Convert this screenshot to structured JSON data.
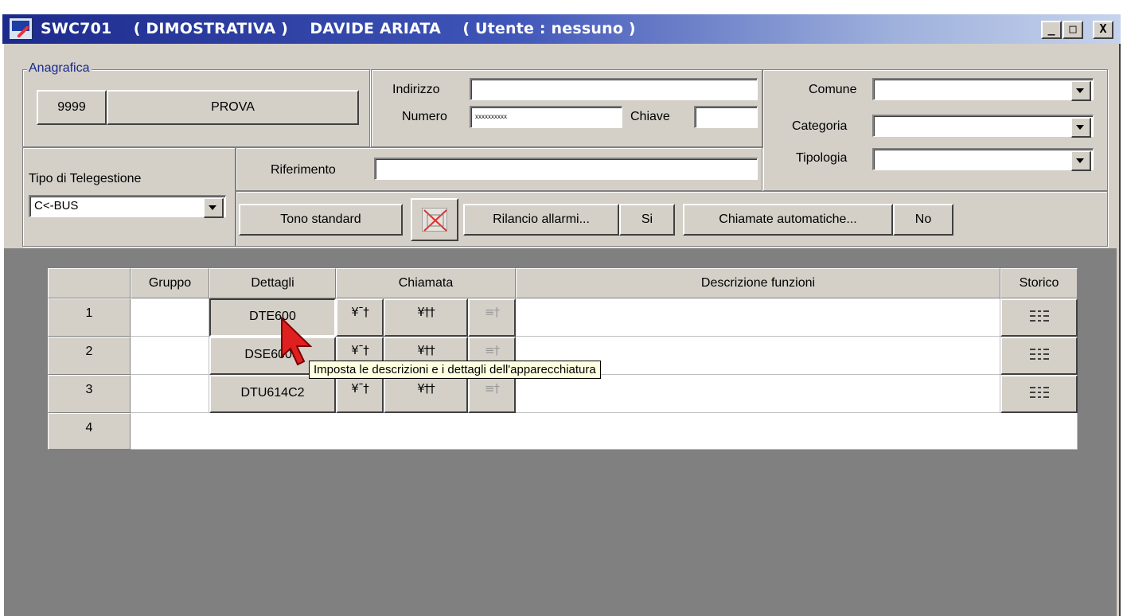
{
  "window": {
    "title": "SWC701    ( DIMOSTRATIVA )    DAVIDE ARIATA    ( Utente : nessuno )",
    "controls": {
      "minimize": "_",
      "maximize": "□",
      "close": "X"
    }
  },
  "anagrafica": {
    "legend": "Anagrafica",
    "code": "9999",
    "name": "PROVA",
    "indirizzo_label": "Indirizzo",
    "indirizzo_value": "",
    "numero_label": "Numero",
    "numero_value": "xxxxxxxxxx",
    "chiave_label": "Chiave",
    "chiave_value": "",
    "comune_label": "Comune",
    "comune_value": "",
    "categoria_label": "Categoria",
    "categoria_value": "",
    "tipologia_label": "Tipologia",
    "tipologia_value": "",
    "riferimento_label": "Riferimento",
    "riferimento_value": ""
  },
  "telegestione": {
    "label": "Tipo di Telegestione",
    "selected": "C<-BUS"
  },
  "toolbar": {
    "tono": "Tono standard",
    "rilancio": "Rilancio allarmi...",
    "rilancio_value": "Si",
    "chiamate": "Chiamate automatiche...",
    "chiamate_value": "No"
  },
  "grid": {
    "headers": {
      "gruppo": "Gruppo",
      "dettagli": "Dettagli",
      "chiamata": "Chiamata",
      "descrizione": "Descrizione funzioni",
      "storico": "Storico"
    },
    "rows": [
      {
        "num": "1",
        "gruppo": "",
        "dettagli": "DTE600",
        "descrizione": ""
      },
      {
        "num": "2",
        "gruppo": "",
        "dettagli": "DSE600S",
        "descrizione": ""
      },
      {
        "num": "3",
        "gruppo": "",
        "dettagli": "DTU614C2",
        "descrizione": ""
      },
      {
        "num": "4",
        "gruppo": "",
        "dettagli": "",
        "descrizione": ""
      }
    ]
  },
  "tooltip": "Imposta le descrizioni e i dettagli dell'apparecchiatura",
  "icons": {
    "app": "app-icon",
    "cursor": "arrow-cursor-icon",
    "no_tone": "no-tone-icon",
    "storico": "list-icon"
  },
  "colors": {
    "titlebar_start": "#1c2a8c",
    "titlebar_end": "#c6d3ec",
    "face": "#d4d0c8",
    "grid_bg": "#808080",
    "tooltip_bg": "#ffffe1",
    "cursor": "#e02020"
  }
}
